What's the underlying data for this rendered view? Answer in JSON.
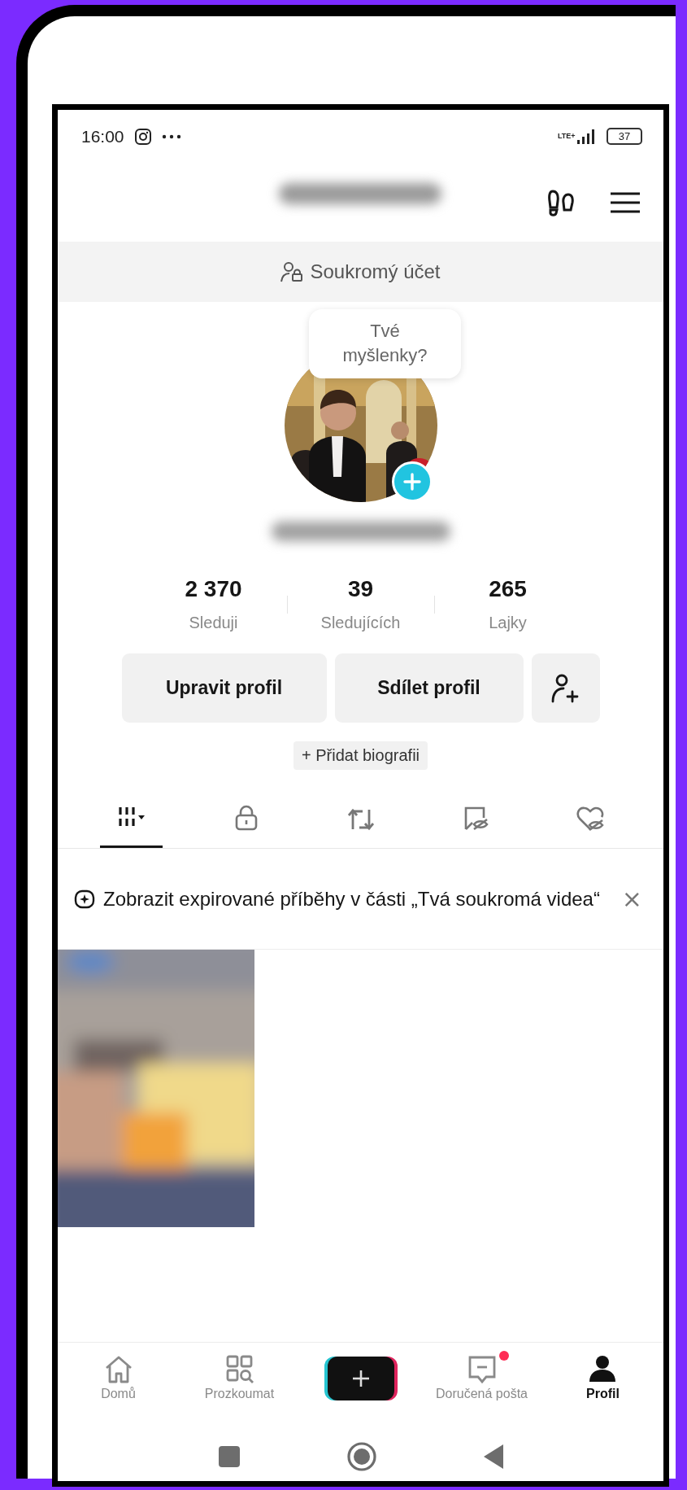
{
  "status_bar": {
    "time": "16:00",
    "network": "LTE+",
    "battery": "37"
  },
  "private_banner": {
    "label": "Soukromý účet"
  },
  "profile": {
    "bubble": "Tvé myšlenky?",
    "stats": [
      {
        "value": "2 370",
        "label": "Sleduji"
      },
      {
        "value": "39",
        "label": "Sledujících"
      },
      {
        "value": "265",
        "label": "Lajky"
      }
    ],
    "buttons": [
      "Upravit profil",
      "Sdílet profil"
    ],
    "add_bio": "+ Přidat biografii"
  },
  "content_tabs": [
    {
      "kind": "grid",
      "selected": true
    },
    {
      "kind": "lock",
      "selected": false
    },
    {
      "kind": "repost",
      "selected": false
    },
    {
      "kind": "saved",
      "selected": false
    },
    {
      "kind": "liked",
      "selected": false
    }
  ],
  "notice": {
    "text": "Zobrazit expirované příběhy v části „Tvá soukromá videa“",
    "close": "×"
  },
  "bottom_nav": [
    {
      "kind": "home",
      "label": "Domů",
      "selected": false,
      "badge": false
    },
    {
      "kind": "explore",
      "label": "Prozkoumat",
      "selected": false,
      "badge": false
    },
    {
      "kind": "create"
    },
    {
      "kind": "inbox",
      "label": "Doručená pošta",
      "selected": false,
      "badge": true
    },
    {
      "kind": "profile",
      "label": "Profil",
      "selected": true,
      "badge": false
    }
  ]
}
